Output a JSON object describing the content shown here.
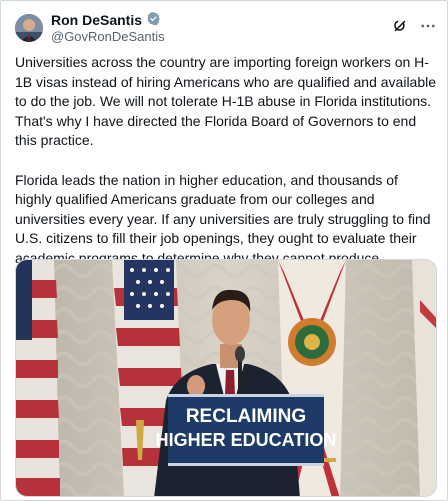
{
  "author": {
    "name": "Ron DeSantis",
    "handle": "@GovRonDeSantis",
    "verified_icon": "verified-badge-icon",
    "verified_color": "#829aab"
  },
  "actions": {
    "grok_icon": "grok-icon",
    "more_icon": "more-icon"
  },
  "post": {
    "paragraph1": "Universities across the country are importing foreign workers on H-1B visas instead of hiring Americans who are qualified and available to do the job. We will not tolerate H-1B abuse in Florida institutions. That's why I have directed the Florida Board of Governors to end this practice.",
    "paragraph2": "Florida leads the nation in higher education, and thousands of highly qualified Americans graduate from our colleges and universities every year. If any universities are truly struggling to find U.S. citizens to fill their job openings, they ought to evaluate their academic programs to determine why they cannot produce graduates who can be hired for these positions."
  },
  "media": {
    "sign_line1": "RECLAIMING",
    "sign_line2": "HIGHER EDUCATION",
    "sign_color": "#1f3a64"
  }
}
